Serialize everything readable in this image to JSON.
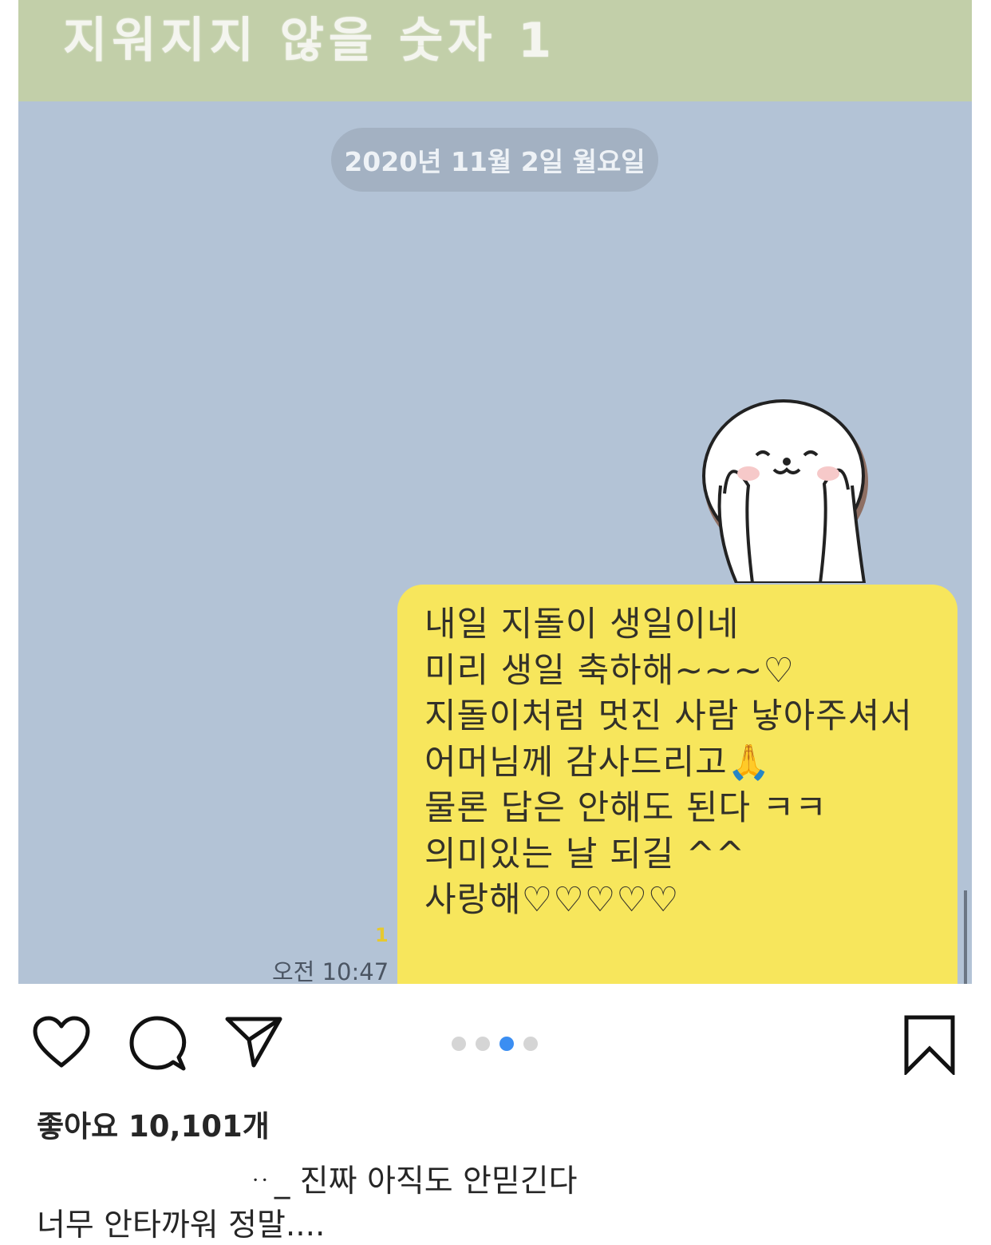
{
  "photo": {
    "title": "지워지지 않을 숫자 1",
    "date": "2020년 11월 2일 월요일",
    "message_lines": [
      "내일 지돌이 생일이네",
      "미리 생일 축하해~~~♡",
      "지돌이처럼 멋진 사람 낳아주셔서",
      "어머님께 감사드리고🙏",
      "물론 답은 안해도 된다 ㅋㅋ",
      "의미있는 날 되길 ^^",
      "사랑해♡♡♡♡♡"
    ],
    "unread_count": "1",
    "time": "오전 10:47"
  },
  "actions": {
    "like_icon": "heart-icon",
    "comment_icon": "comment-icon",
    "share_icon": "send-icon",
    "save_icon": "bookmark-icon"
  },
  "carousel": {
    "count": 4,
    "active_index": 2,
    "active_color": "#3b8ef2"
  },
  "likes": "좋아요 10,101개",
  "caption": {
    "username_fragment": "ᆢ_",
    "text": "진짜 아직도 안믿긴다",
    "line2": "너무 안타까워 정말...."
  }
}
